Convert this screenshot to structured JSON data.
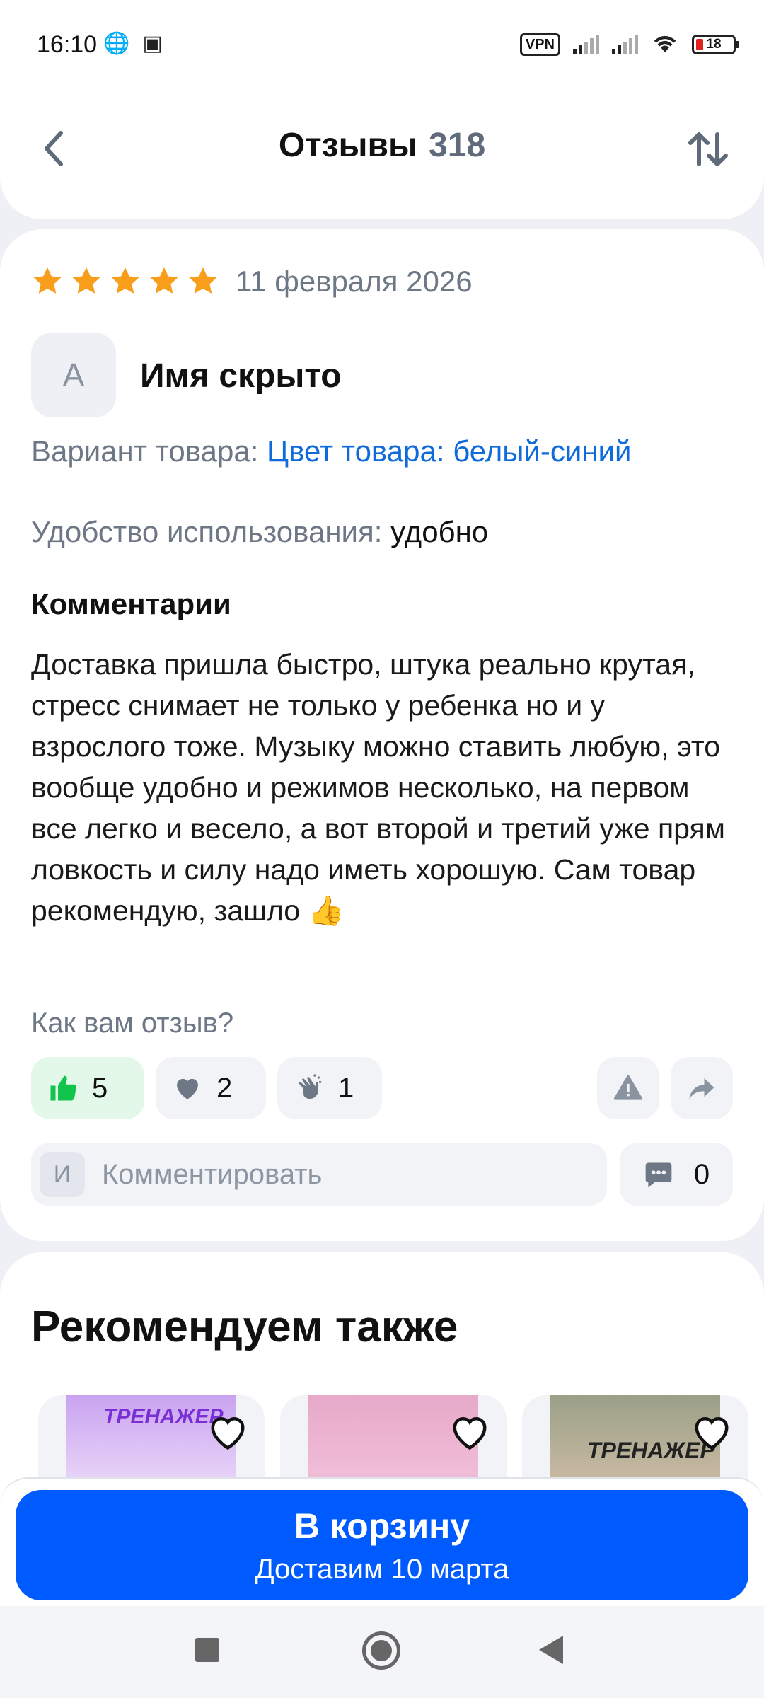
{
  "status_bar": {
    "time": "16:10",
    "vpn": "VPN",
    "battery": "18"
  },
  "header": {
    "title": "Отзывы",
    "count": "318"
  },
  "review": {
    "rating": 5,
    "date": "11 февраля 2026",
    "avatar_letter": "А",
    "author": "Имя скрыто",
    "variant_label": "Вариант товара:",
    "variant_value": "Цвет товара: белый-синий",
    "usability_label": "Удобство использования:",
    "usability_value": "удобно",
    "comments_title": "Комментарии",
    "comment_text": "Доставка пришла быстро, штука реально крутая, стресс снимает не только у ребенка но и у взрослого тоже. Музыку можно ставить любую, это вообще удобно и режимов несколько, на первом все легко и весело, а вот второй и третий уже прям ловкость и силу надо иметь хорошую. Сам товар рекомендую, зашло 👍",
    "question": "Как вам отзыв?",
    "reactions": {
      "like": "5",
      "heart": "2",
      "clap": "1"
    },
    "comment_avatar_letter": "И",
    "comment_placeholder": "Комментировать",
    "comment_count": "0"
  },
  "recommend": {
    "title": "Рекомендуем также",
    "products": [
      {
        "label": "ТРЕНАЖЕР"
      },
      {
        "label": ""
      },
      {
        "label": "ТРЕНАЖЕР"
      }
    ]
  },
  "cart": {
    "label": "В корзину",
    "delivery": "Доставим 10 марта"
  },
  "colors": {
    "accent": "#005bff",
    "link": "#0f6bdc",
    "star": "#f99e1a",
    "like_bg": "#e3f8e9",
    "like_icon": "#10c44c"
  }
}
